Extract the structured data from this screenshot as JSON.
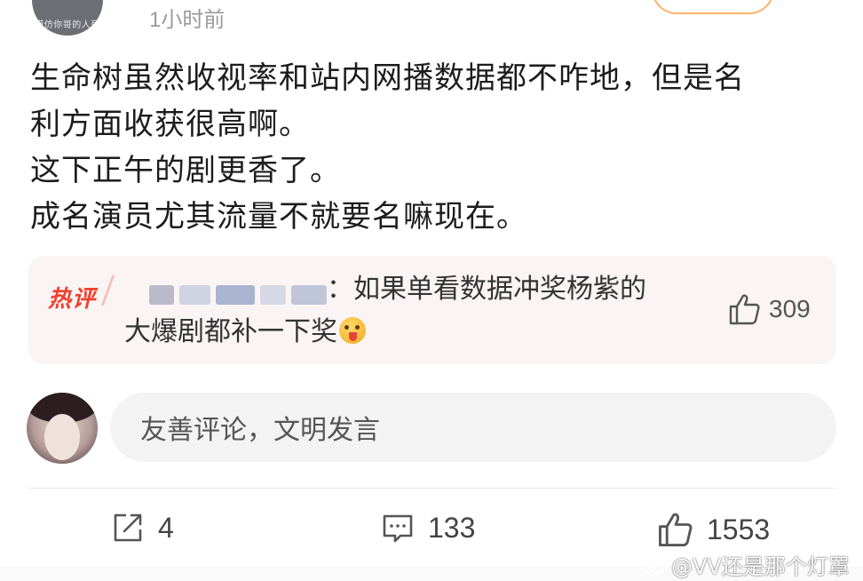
{
  "header": {
    "avatar_caption": "模仿你哥的人死",
    "time": "1小时前"
  },
  "post": {
    "lines": [
      "生命树虽然收视率和站内网播数据都不咋地，但是名",
      "利方面收获很高啊。",
      "这下正午的剧更香了。",
      "成名演员尤其流量不就要名嘛现在。"
    ]
  },
  "hot_comment": {
    "badge": "热评",
    "text_line1": "：如果单看数据冲奖杨紫的",
    "text_line2": "大爆剧都补一下奖",
    "emoji": "tongue-out-emoji",
    "like_count": "309"
  },
  "reply": {
    "placeholder": "友善评论，文明发言"
  },
  "actions": {
    "share_count": "4",
    "comment_count": "133",
    "like_count": "1553"
  },
  "watermark": {
    "text": "@VV还是那个灯罩"
  },
  "colors": {
    "hot_badge": "#f0402f",
    "follow_border": "#ffb36a",
    "hot_card_bg": "#faf4f4",
    "input_bg": "#f3f3f3"
  }
}
